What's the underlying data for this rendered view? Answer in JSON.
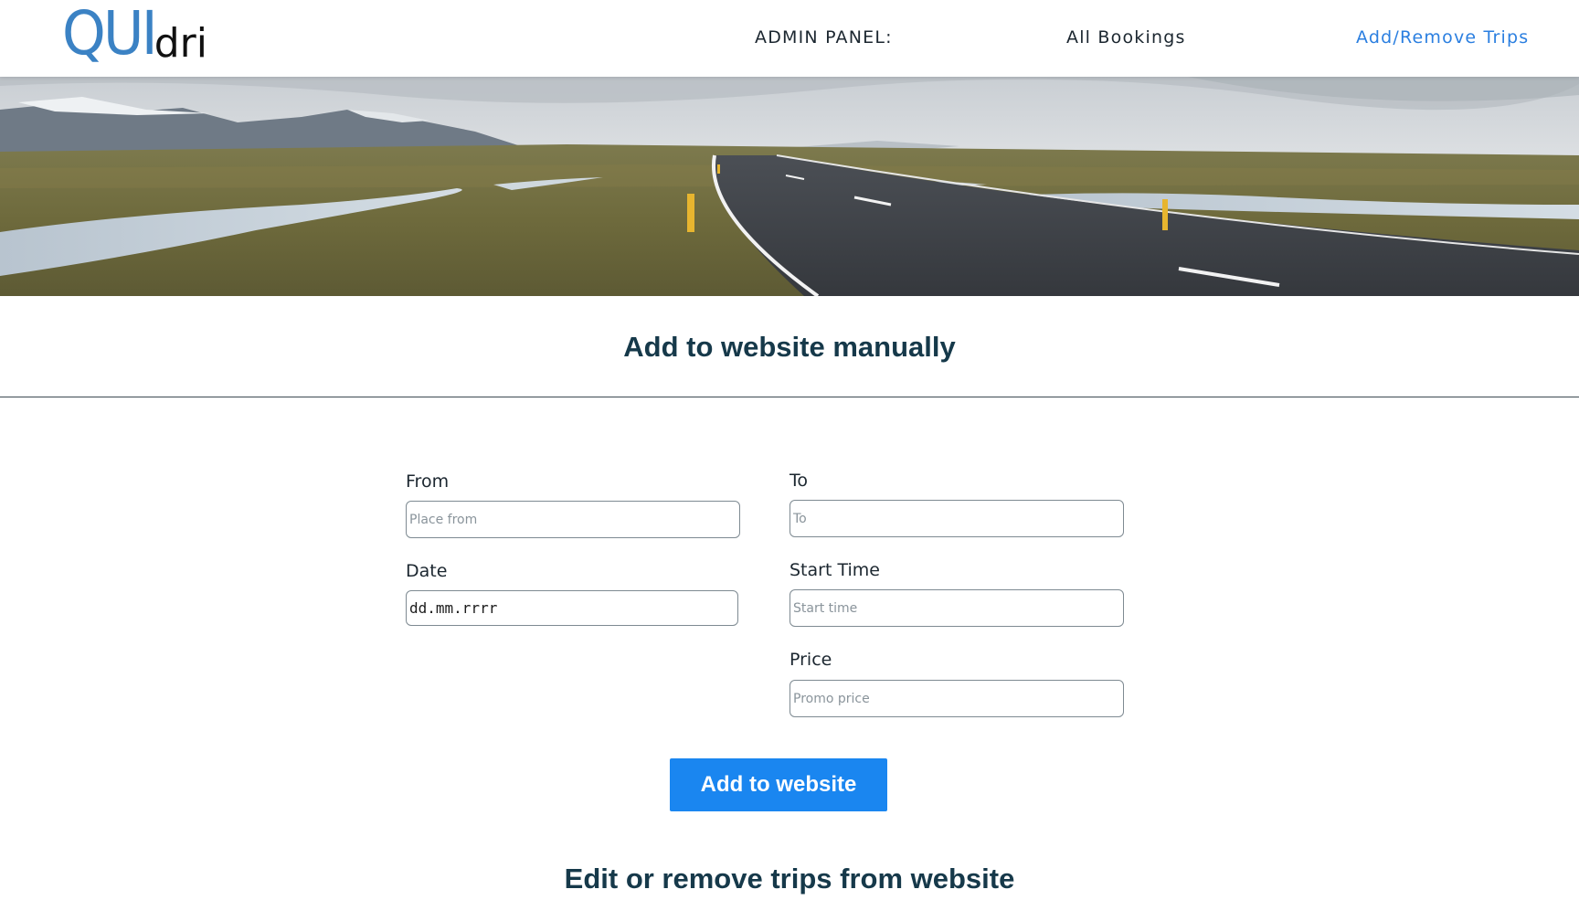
{
  "brand": {
    "logo_main": "QUI",
    "logo_sub": "dri",
    "logo_color": "#3b82c4"
  },
  "nav": {
    "admin_label": "ADMIN PANEL:",
    "bookings_label": "All Bookings",
    "trips_label": "Add/Remove Trips",
    "active_color": "#2b7fe0"
  },
  "hero": {
    "image": "road-landscape-banner"
  },
  "add_section": {
    "title": "Add to website manually",
    "fields": {
      "from": {
        "label": "From",
        "placeholder": "Place from",
        "value": ""
      },
      "to": {
        "label": "To",
        "placeholder": "To",
        "value": ""
      },
      "date": {
        "label": "Date",
        "value": "dd.mm.rrrr"
      },
      "start_time": {
        "label": "Start Time",
        "placeholder": "Start time",
        "value": ""
      },
      "price": {
        "label": "Price",
        "placeholder": "Promo price",
        "value": ""
      }
    },
    "submit_label": "Add to website",
    "submit_color": "#1a86f0"
  },
  "edit_section": {
    "title": "Edit or remove trips from website"
  }
}
